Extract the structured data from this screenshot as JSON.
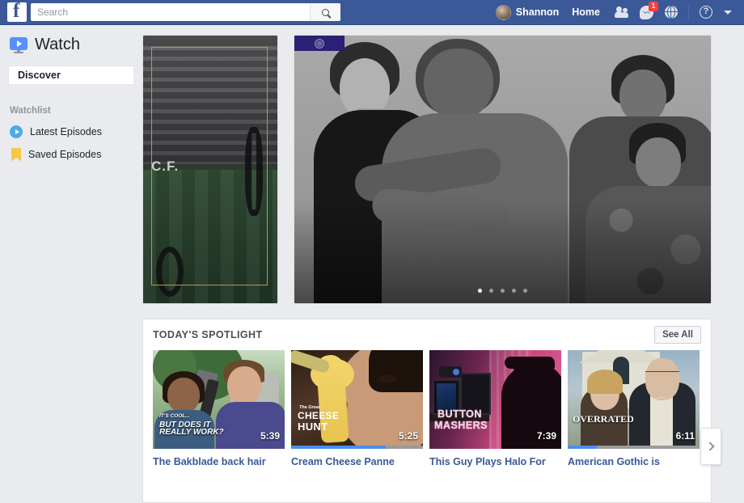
{
  "topbar": {
    "logo": "facebook-f",
    "search": {
      "value": "",
      "placeholder": "Search",
      "icon": "search-icon"
    },
    "user_name": "Shannon",
    "home_label": "Home",
    "icons": {
      "friends": "friends-icon",
      "messenger": "messenger-icon",
      "messenger_badge": "1",
      "globe": "globe-icon",
      "help": "help-icon",
      "caret": "chevron-down-icon"
    },
    "colors": {
      "bar": "#3b5998",
      "badge": "#fa3e3e"
    }
  },
  "sidebar": {
    "app_title": "Watch",
    "app_icon": "watch-monitor-icon",
    "tabs": [
      {
        "label": "Discover",
        "selected": true
      }
    ],
    "section_label": "Watchlist",
    "items": [
      {
        "label": "Latest Episodes",
        "icon": "play-circle-icon"
      },
      {
        "label": "Saved Episodes",
        "icon": "bookmark-icon"
      }
    ]
  },
  "hero": {
    "left_card": {
      "caption": "C.F.",
      "alt": "stadium-thumbnail"
    },
    "carousel": {
      "alt": "family-photo-grayscale",
      "banner_icon": "network-seal-icon",
      "dots_total": 5,
      "active_dot": 1
    }
  },
  "spotlight": {
    "title": "TODAY'S SPOTLIGHT",
    "see_all_label": "See All",
    "next_icon": "chevron-right-icon",
    "cards": [
      {
        "title": "The Bakblade back hair",
        "duration": "5:39",
        "overlay_small": "IT'S COOL...",
        "overlay_line1": "BUT DOES IT",
        "overlay_line2": "REALLY WORK?",
        "progress_percent": 0
      },
      {
        "title": "Cream Cheese Panne",
        "duration": "5:25",
        "overlay_small": "The Great",
        "overlay_line1": "CHEESE",
        "overlay_line2": "HUNT",
        "progress_percent": 72
      },
      {
        "title": "This Guy Plays Halo For",
        "duration": "7:39",
        "overlay_line1": "BUTTON",
        "overlay_line2": "MASHERS",
        "progress_percent": 0
      },
      {
        "title": "American Gothic is",
        "duration": "6:11",
        "overlay_line1": "OVERRATED",
        "progress_percent": 22
      }
    ]
  }
}
